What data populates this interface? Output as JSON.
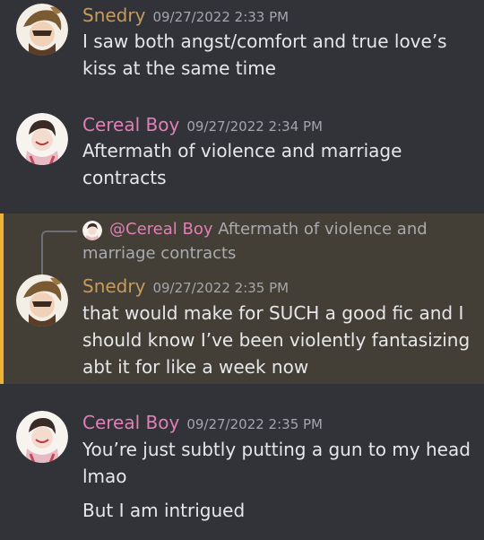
{
  "messages": [
    {
      "username": "Snedry",
      "timestamp": "09/27/2022 2:33 PM",
      "lines": [
        "I saw both angst/comfort and true love’s",
        "kiss at the same time"
      ]
    },
    {
      "username": "Cereal Boy",
      "timestamp": "09/27/2022 2:34 PM",
      "lines": [
        "Aftermath of violence and marriage",
        "contracts"
      ]
    },
    {
      "username": "Snedry",
      "timestamp": "09/27/2022 2:35 PM",
      "reply": {
        "mention": "@Cereal Boy",
        "text_line1": "Aftermath of violence and",
        "text_line2": "marriage contracts"
      },
      "lines": [
        "that would make for SUCH a good fic and I",
        "should know I’ve been violently fantasizing",
        "abt it for like a week now"
      ]
    },
    {
      "username": "Cereal Boy",
      "timestamp": "09/27/2022 2:35 PM",
      "lines": [
        "You’re just subtly putting a gun to my head",
        "lmao"
      ],
      "followup": "But I am intrigued"
    }
  ],
  "colors": {
    "background": "#313338",
    "snedry_name": "#c99b5a",
    "cereal_name": "#e27fb6",
    "highlight_bg": "#433f37",
    "highlight_bar": "#f0b232"
  },
  "icons": {
    "snedry_avatar": "snedry-avatar-icon",
    "cereal_avatar": "cereal-boy-avatar-icon"
  }
}
